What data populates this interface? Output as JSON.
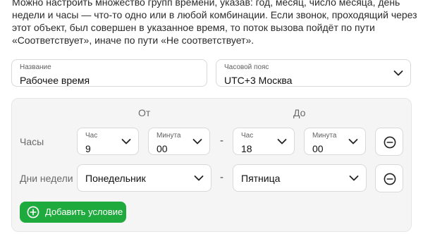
{
  "description": "Можно настроить множество групп времени, указав: год, месяц, число месяца, день недели и часы — что-то одно или в любой комбинации. Если звонок, проходящий через этот объект, был совершен в указанное время, то поток вызова пойдёт по пути «Соответствует», иначе по пути «Не соответствует».",
  "name_field": {
    "label": "Название",
    "value": "Рабочее время"
  },
  "timezone_field": {
    "label": "Часовой пояс",
    "value": "UTC+3 Москва"
  },
  "columns": {
    "from": "От",
    "to": "До"
  },
  "hours_row": {
    "label": "Часы",
    "from_hour": {
      "label": "Час",
      "value": "9"
    },
    "from_minute": {
      "label": "Минута",
      "value": "00"
    },
    "to_hour": {
      "label": "Час",
      "value": "18"
    },
    "to_minute": {
      "label": "Минута",
      "value": "00"
    },
    "separator": "-"
  },
  "weekdays_row": {
    "label": "Дни недели",
    "from_day": "Понедельник",
    "to_day": "Пятница",
    "separator": "-"
  },
  "add_condition_label": "Добавить условие",
  "colors": {
    "accent": "#1faa3e",
    "panel_bg": "#f5f5f5",
    "border": "#d9d9d9"
  },
  "icons": [
    "chevron-down-icon",
    "minus-circle-icon",
    "plus-circle-icon"
  ]
}
